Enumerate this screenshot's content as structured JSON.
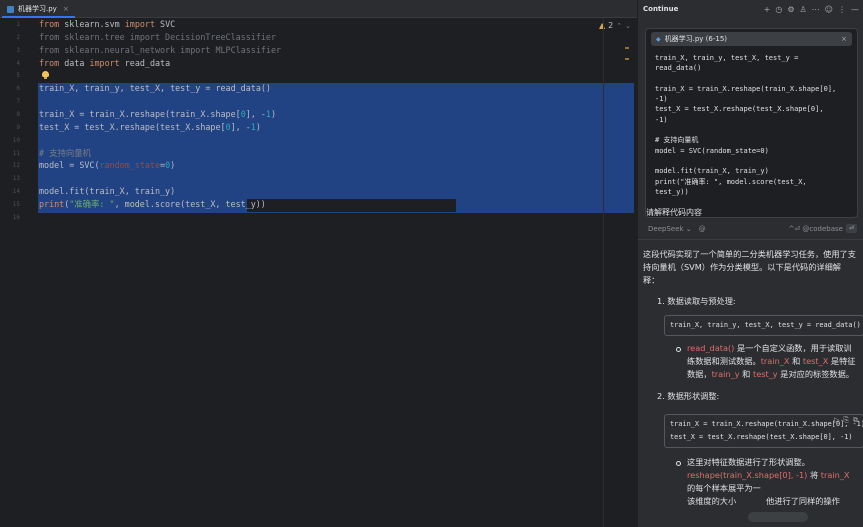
{
  "editor": {
    "tab_label": "机器学习.py",
    "tab_close": "×",
    "warning_count": "2",
    "gutter_lines": [
      "1",
      "2",
      "3",
      "4",
      "5",
      "6",
      "7",
      "8",
      "9",
      "10",
      "11",
      "12",
      "13",
      "14",
      "15",
      "16"
    ],
    "code": [
      {
        "n": 1,
        "parts": [
          [
            "kw",
            "from "
          ],
          [
            "t",
            "sklearn.svm "
          ],
          [
            "kw",
            "import "
          ],
          [
            "t",
            "SVC"
          ]
        ]
      },
      {
        "n": 2,
        "parts": [
          [
            "dim",
            "from sklearn.tree import DecisionTreeClassifier"
          ]
        ]
      },
      {
        "n": 3,
        "parts": [
          [
            "dim",
            "from sklearn.neural_network import MLPClassifier"
          ]
        ]
      },
      {
        "n": 4,
        "parts": [
          [
            "kw",
            "from "
          ],
          [
            "t",
            "data "
          ],
          [
            "kw",
            "import "
          ],
          [
            "t",
            "read_data"
          ]
        ]
      },
      {
        "n": 6,
        "parts": [
          [
            "t",
            "train_X, train_y, test_X, test_y = read_data()"
          ]
        ]
      },
      {
        "n": 8,
        "parts": [
          [
            "t",
            "train_X = train_X.reshape(train_X.shape["
          ],
          [
            "num",
            "0"
          ],
          [
            "t",
            "], -"
          ],
          [
            "num",
            "1"
          ],
          [
            "t",
            ")"
          ]
        ]
      },
      {
        "n": 9,
        "parts": [
          [
            "t",
            "test_X = test_X.reshape(test_X.shape["
          ],
          [
            "num",
            "0"
          ],
          [
            "t",
            "], -"
          ],
          [
            "num",
            "1"
          ],
          [
            "t",
            ")"
          ]
        ]
      },
      {
        "n": 11,
        "parts": [
          [
            "cmt",
            "# 支持向量机"
          ]
        ]
      },
      {
        "n": 12,
        "parts": [
          [
            "t",
            "model = SVC("
          ],
          [
            "param",
            "random_state"
          ],
          [
            "t",
            "="
          ],
          [
            "num",
            "0"
          ],
          [
            "t",
            ")"
          ]
        ]
      },
      {
        "n": 14,
        "parts": [
          [
            "t",
            "model.fit(train_X, train_y)"
          ]
        ]
      },
      {
        "n": 15,
        "parts": [
          [
            "kw",
            "print"
          ],
          [
            "t",
            "("
          ],
          [
            "str",
            "\"准确率: \""
          ],
          [
            "t",
            ", model.score(test_X, test_y))"
          ]
        ]
      }
    ]
  },
  "panel": {
    "title": "Continue",
    "header_icons": [
      "+",
      "◷",
      "⚙",
      "♙",
      "⋯",
      "☺",
      "⋮",
      "—"
    ],
    "context_chip": "机器学习.py (6-15)",
    "context_close": "×",
    "context_code": "train_X, train_y, test_X, test_y =\nread_data()\n\ntrain_X = train_X.reshape(train_X.shape[0],\n-1)\ntest_X = test_X.reshape(test_X.shape[0],\n-1)\n\n# 支持向量机\nmodel = SVC(random_state=0)\n\nmodel.fit(train_X, train_y)\nprint(\"准确率: \", model.score(test_X,\ntest_y))",
    "prompt": "请解释代码内容",
    "model_selector": "DeepSeek ⌄",
    "attach_icon": "@",
    "shortcut": "^⏎ @codebase",
    "enter_icon": "⏎",
    "answer": {
      "intro": "这段代码实现了一个简单的二分类机器学习任务，使用了支持向量机（SVM）作为分类模型。以下是代码的详细解释：",
      "h1": "1. 数据读取与预处理:",
      "code1": "train_X, train_y, test_X, test_y = read_data()",
      "b1_hl1": "read_data()",
      "b1_t1": " 是一个自定义函数，用于读取训练数据和测试数据。",
      "b1_hl2": "train_X",
      "b1_t2": " 和 ",
      "b1_hl3": "test_X",
      "b1_t3": " 是特征数据，",
      "b1_hl4": "train_y",
      "b1_t4": " 和 ",
      "b1_hl5": "test_y",
      "b1_t5": " 是对应的标签数据。",
      "h2": "2. 数据形状调整:",
      "code2a": "train_X = train_X.reshape(train_X.shape[0], -1)",
      "code2b": "test_X = test_X.reshape(test_X.shape[0], -1)",
      "code_tools": [
        "▷",
        "⎘",
        "⧉"
      ],
      "b2_t1": "这里对特征数据进行了形状调整。",
      "b2_hl1": "reshape(train_X.shape[0], -1)",
      "b2_t2": " 将 ",
      "b2_hl2": "train_X",
      "b2_t3": " 的每个样本展平为一",
      "b2_t4": "该维度的大小",
      "b2_t5": "他进行了同样的操作"
    }
  }
}
